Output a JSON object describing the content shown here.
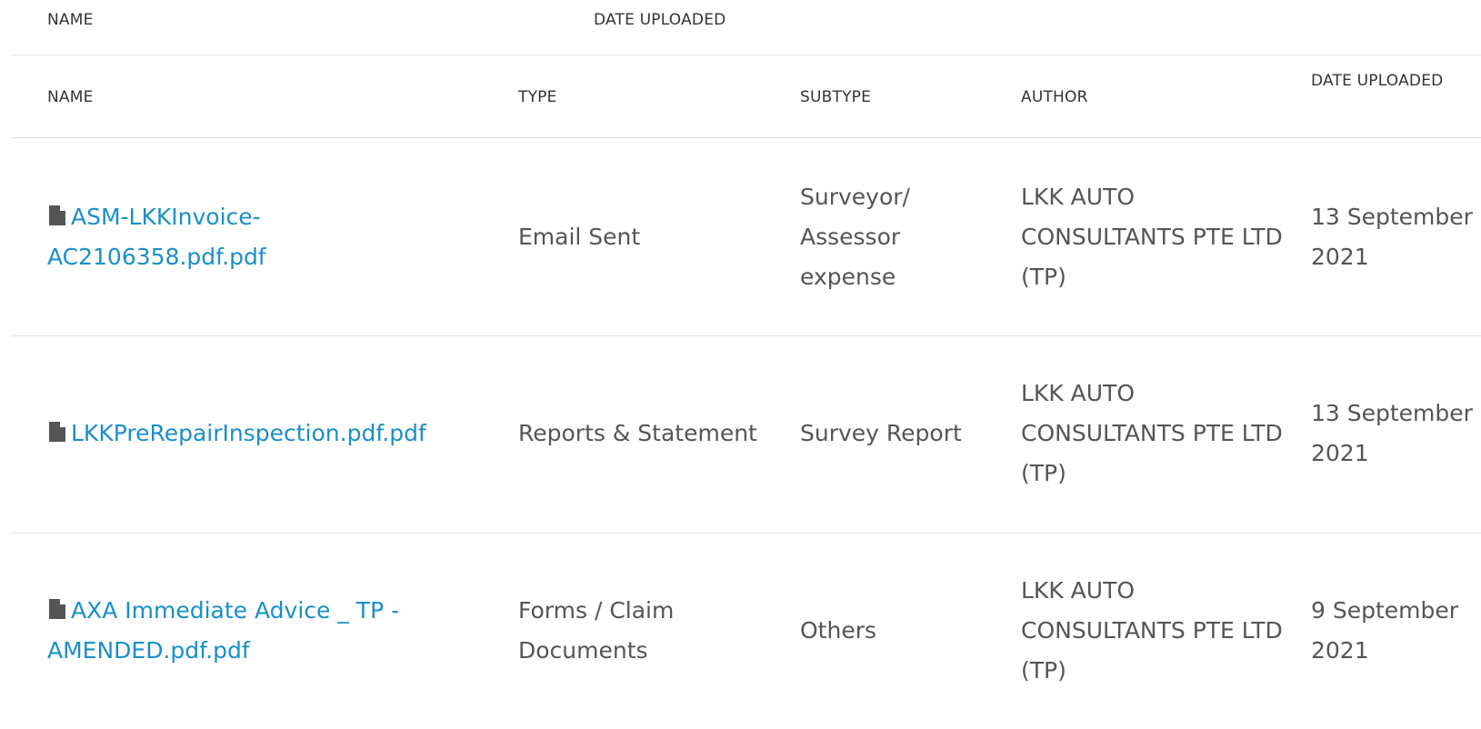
{
  "sticky_header": {
    "name": "NAME",
    "date_uploaded": "DATE UPLOADED"
  },
  "table": {
    "columns": {
      "name": "NAME",
      "type": "TYPE",
      "subtype": "SUBTYPE",
      "author": "AUTHOR",
      "date_uploaded": "DATE UPLOADED"
    },
    "rows": [
      {
        "name": "ASM-LKKInvoice-AC2106358.pdf.pdf",
        "type": "Email Sent",
        "subtype": "Surveyor/ Assessor expense",
        "author": "LKK AUTO CONSULTANTS PTE LTD (TP)",
        "date": "13 September 2021"
      },
      {
        "name": "LKKPreRepairInspection.pdf.pdf",
        "type": "Reports & Statement",
        "subtype": "Survey Report",
        "author": "LKK AUTO CONSULTANTS PTE LTD (TP)",
        "date": "13 September 2021"
      },
      {
        "name": "AXA Immediate Advice _ TP - AMENDED.pdf.pdf",
        "type": "Forms / Claim Documents",
        "subtype": "Others",
        "author": "LKK AUTO CONSULTANTS PTE LTD (TP)",
        "date": "9 September 2021"
      }
    ]
  },
  "icons": {
    "file": "file-icon"
  },
  "colors": {
    "link": "#1a8fc9",
    "text": "#555555",
    "header": "#333333",
    "divider": "#e3e3e3",
    "icon": "#555555"
  }
}
